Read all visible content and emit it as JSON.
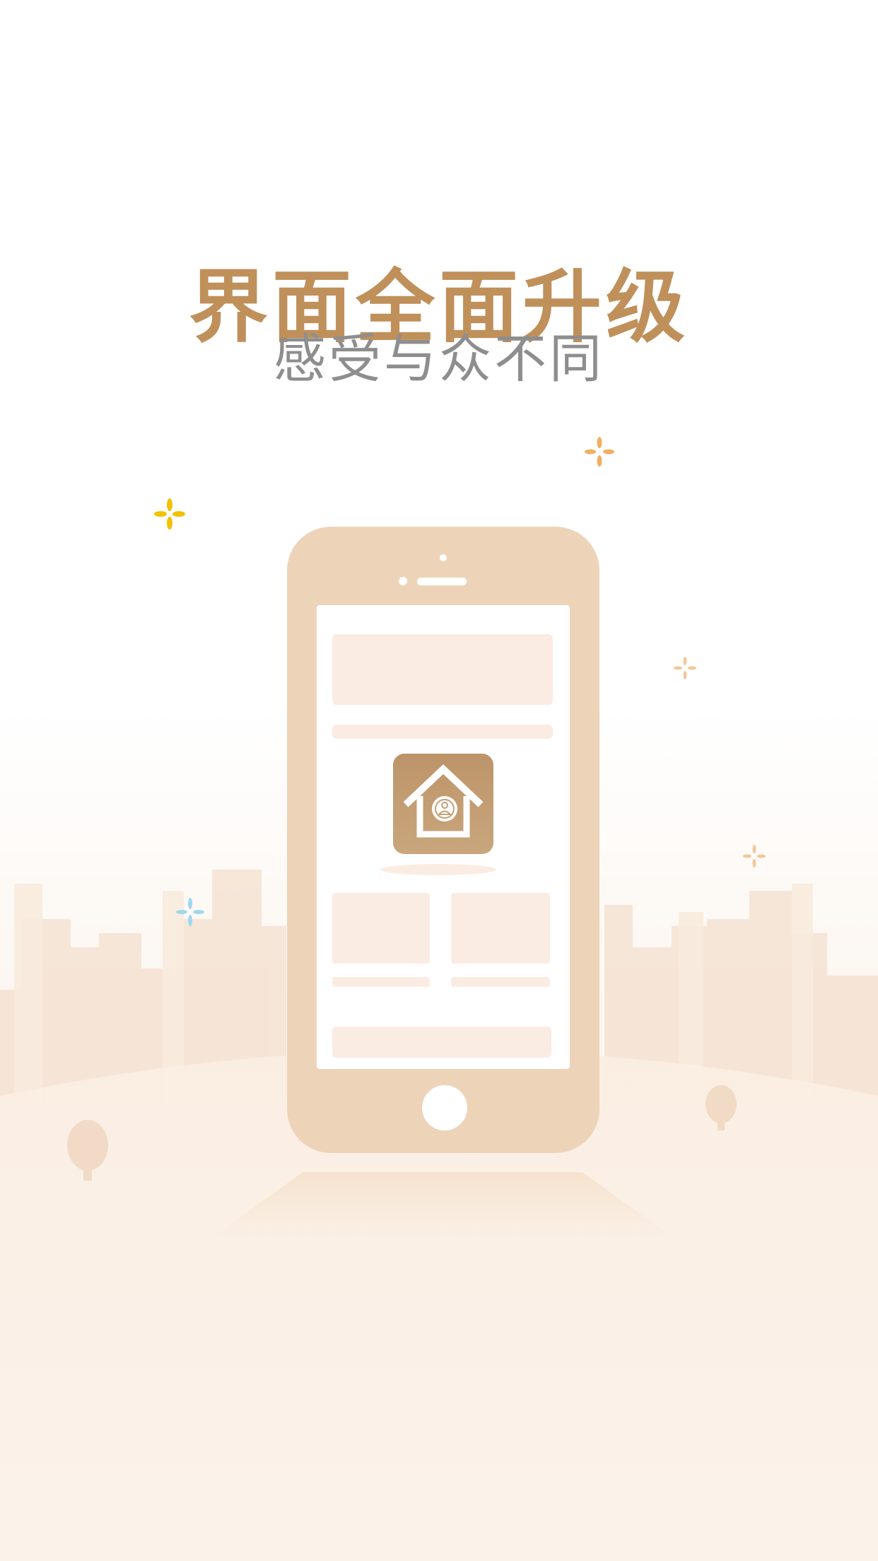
{
  "splash": {
    "title": "界面全面升级",
    "subtitle": "感受与众不同"
  },
  "colors": {
    "accent": "#c0905a",
    "phone_body": "#edd4b9",
    "screen_block": "#fbece3",
    "subtitle_text": "#8e8e8e",
    "sparkle_yellow": "#f2c200",
    "sparkle_orange": "#f0b060",
    "sparkle_blue": "#9fd7f0"
  },
  "icons": {
    "app_icon": "house-person-icon",
    "decor": [
      "sparkle-icon",
      "tree-icon",
      "city-skyline"
    ]
  }
}
